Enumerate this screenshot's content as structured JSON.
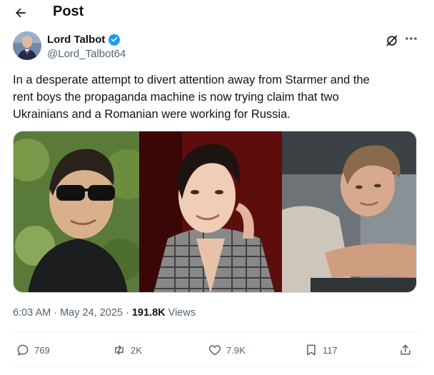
{
  "header": {
    "title": "Post"
  },
  "author": {
    "name": "Lord Talbot",
    "handle": "@Lord_Talbot64"
  },
  "tweet": {
    "text": "In a desperate attempt to divert attention away from Starmer and the\nrent boys the propaganda machine is now trying claim that two\nUkrainians and a Romanian were working for Russia."
  },
  "meta": {
    "time": "6:03 AM",
    "date": "May 24, 2025",
    "views_count": "191.8K",
    "views_label": "Views"
  },
  "actions": {
    "replies": "769",
    "reposts": "2K",
    "likes": "7.9K",
    "bookmarks": "117"
  },
  "colors": {
    "accent": "#1d9bf0",
    "muted": "#536471",
    "text": "#0f1419"
  }
}
